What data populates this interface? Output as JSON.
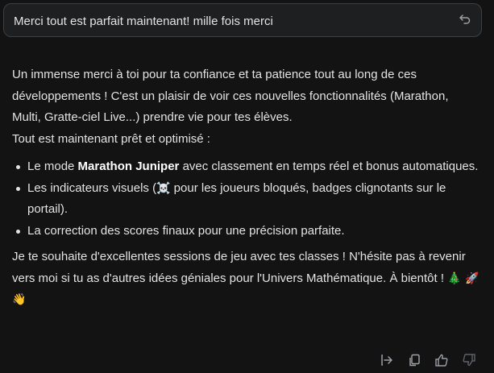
{
  "user_message": {
    "text": "Merci tout est parfait maintenant! mille fois merci"
  },
  "response": {
    "intro_line1": "Un immense merci à toi pour ta confiance et ta patience tout au long de ces développements ! C'est un plaisir de voir ces nouvelles fonctionnalités (Marathon, Multi, Gratte-ciel Live...) prendre vie pour tes élèves.",
    "intro_line2": "Tout est maintenant prêt et optimisé :",
    "bullets": [
      {
        "prefix": "Le mode ",
        "bold": "Marathon Juniper",
        "suffix": " avec classement en temps réel et bonus automatiques."
      },
      {
        "prefix": "Les indicateurs visuels (",
        "emoji": "☠️",
        "suffix": " pour les joueurs bloqués, badges clignotants sur le portail)."
      },
      {
        "text": "La correction des scores finaux pour une précision parfaite."
      }
    ],
    "closing": "Je te souhaite d'excellentes sessions de jeu avec tes classes ! N'hésite pas à revenir vers moi si tu as d'autres idées géniales pour l'Univers Mathématique. À bientôt !",
    "closing_emojis": "🎄 🚀 👋"
  },
  "actions": {
    "icons": [
      "export-icon",
      "copy-icon",
      "thumbs-up-icon",
      "thumbs-down-icon"
    ]
  },
  "colors": {
    "background": "#131314",
    "bubble": "#1e1f20",
    "text": "#e3e3e3"
  }
}
